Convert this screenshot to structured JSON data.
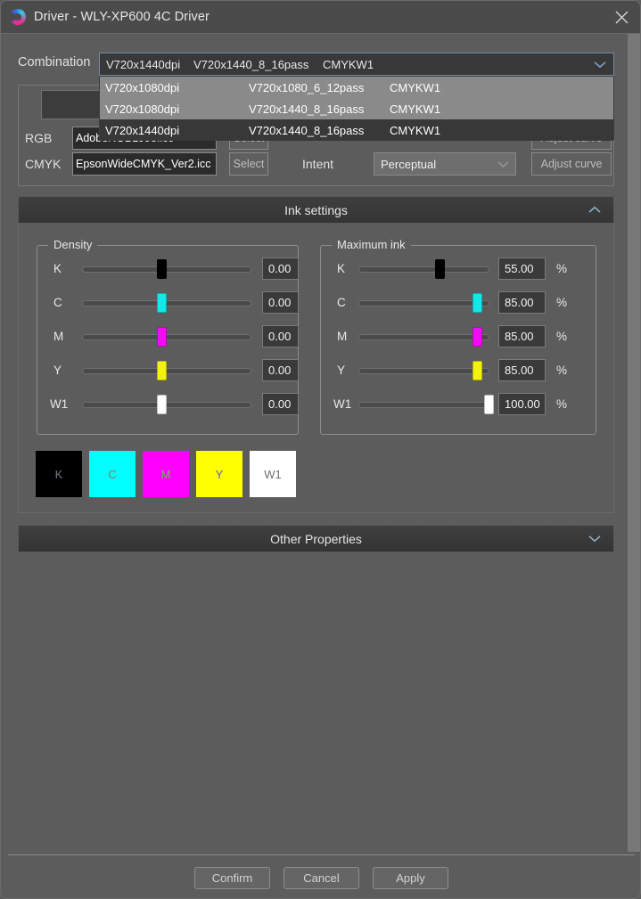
{
  "window": {
    "title": "Driver - WLY-XP600 4C Driver",
    "app_icon": "driver-logo-icon",
    "close_icon": "close-icon"
  },
  "combination": {
    "label": "Combination",
    "selected": {
      "resolution": "V720x1440dpi",
      "mode": "V720x1440_8_16pass",
      "inkset": "CMYKW1"
    },
    "arrow_icon": "chevron-down-icon",
    "options": [
      {
        "resolution": "V720x1080dpi",
        "mode": "V720x1080_6_12pass",
        "inkset": "CMYKW1",
        "selected": false
      },
      {
        "resolution": "V720x1080dpi",
        "mode": "V720x1440_8_16pass",
        "inkset": "CMYKW1",
        "selected": false
      },
      {
        "resolution": "V720x1440dpi",
        "mode": "V720x1440_8_16pass",
        "inkset": "CMYKW1",
        "selected": true
      }
    ]
  },
  "profiles": {
    "rgb": {
      "label": "RGB",
      "value": "AdobeRGB1998.icc",
      "select_label": "Select",
      "adjust_label": "Adjust curve"
    },
    "cmyk": {
      "label": "CMYK",
      "value": "EpsonWideCMYK_Ver2.icc",
      "select_label": "Select",
      "intent_label": "Intent",
      "intent_value": "Perceptual",
      "intent_arrow_icon": "chevron-down-icon",
      "adjust_label": "Adjust curve"
    }
  },
  "ink_settings": {
    "title": "Ink settings",
    "chevron_icon": "chevron-up-icon",
    "density": {
      "legend": "Density",
      "channels": [
        {
          "name": "K",
          "value": "0.00",
          "pos": 50,
          "color": "#000000"
        },
        {
          "name": "C",
          "value": "0.00",
          "pos": 50,
          "color": "#13e8e8"
        },
        {
          "name": "M",
          "value": "0.00",
          "pos": 50,
          "color": "#f20cf2"
        },
        {
          "name": "Y",
          "value": "0.00",
          "pos": 50,
          "color": "#f2f20c"
        },
        {
          "name": "W1",
          "value": "0.00",
          "pos": 50,
          "color": "#ffffff"
        }
      ]
    },
    "maximum_ink": {
      "legend": "Maximum ink",
      "unit": "%",
      "channels": [
        {
          "name": "K",
          "value": "55.00",
          "pos": 55,
          "color": "#000000"
        },
        {
          "name": "C",
          "value": "85.00",
          "pos": 85,
          "color": "#13e8e8"
        },
        {
          "name": "M",
          "value": "85.00",
          "pos": 85,
          "color": "#f20cf2"
        },
        {
          "name": "Y",
          "value": "85.00",
          "pos": 85,
          "color": "#f2f20c"
        },
        {
          "name": "W1",
          "value": "100.00",
          "pos": 100,
          "color": "#ffffff"
        }
      ]
    },
    "swatches": [
      {
        "name": "K",
        "bg": "#000000",
        "fg": "#7a7a8a"
      },
      {
        "name": "C",
        "bg": "#00ffff",
        "fg": "#c06060"
      },
      {
        "name": "M",
        "bg": "#ff00ff",
        "fg": "#60c060"
      },
      {
        "name": "Y",
        "bg": "#ffff00",
        "fg": "#6060c0"
      },
      {
        "name": "W1",
        "bg": "#ffffff",
        "fg": "#707070"
      }
    ]
  },
  "other_properties": {
    "title": "Other Properties",
    "chevron_icon": "chevron-down-icon"
  },
  "footer": {
    "confirm": "Confirm",
    "cancel": "Cancel",
    "apply": "Apply"
  }
}
